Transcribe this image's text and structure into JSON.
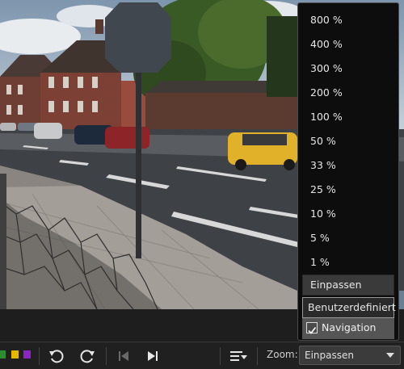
{
  "zoom_menu": {
    "levels": [
      "800 %",
      "400 %",
      "300 %",
      "200 %",
      "100 %",
      "50 %",
      "33 %",
      "25 %",
      "10 %",
      "5 %",
      "1 %"
    ],
    "fit_label": "Einpassen",
    "custom_label": "Benutzerdefiniert",
    "navigation_label": "Navigation",
    "navigation_checked": true
  },
  "toolbar": {
    "color_labels": [
      "#2e8b2e",
      "#e5b800",
      "#8e24c8"
    ],
    "zoom_label": "Zoom:",
    "zoom_value": "Einpassen",
    "icons": [
      "rotate-left-icon",
      "rotate-right-icon",
      "skip-first-icon",
      "skip-last-icon",
      "sort-menu-icon",
      "chevron-down-icon"
    ]
  }
}
